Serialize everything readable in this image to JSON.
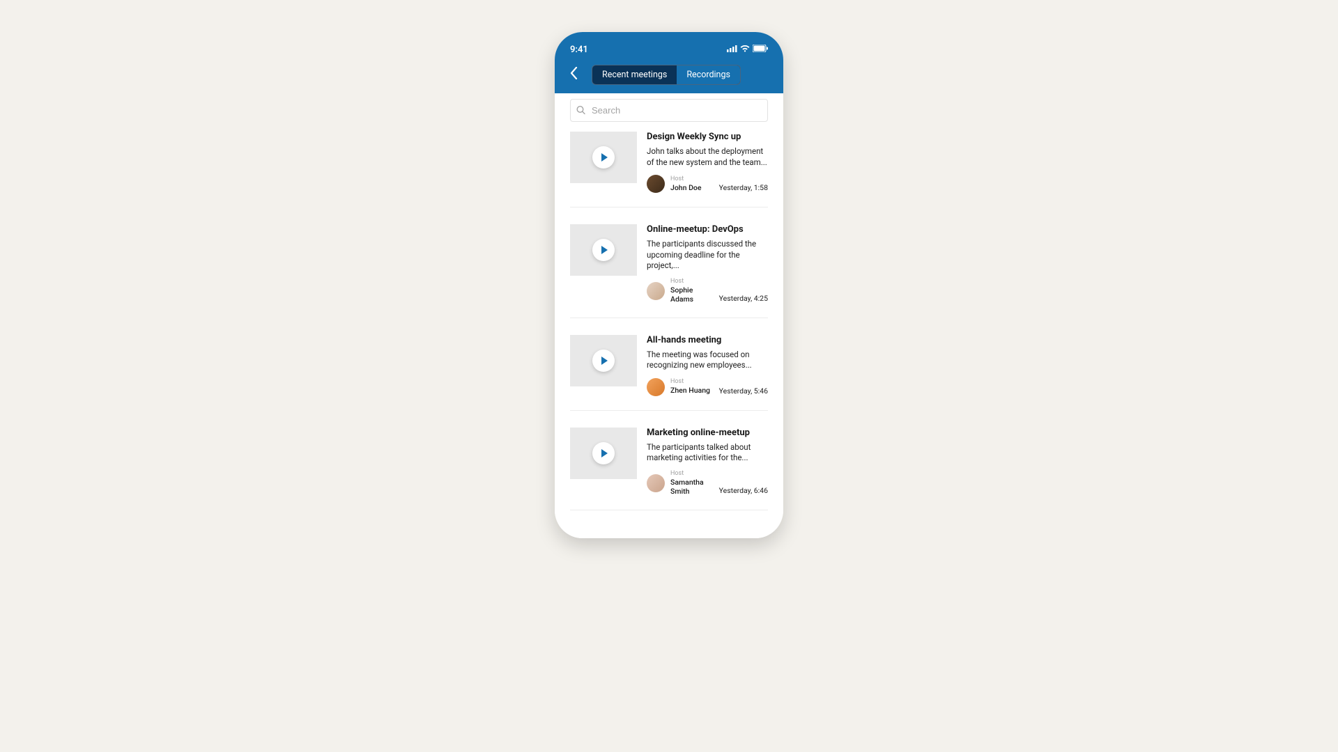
{
  "status": {
    "time": "9:41"
  },
  "tabs": {
    "recent": "Recent meetings",
    "recordings": "Recordings",
    "active": "recordings"
  },
  "search": {
    "placeholder": "Search",
    "value": ""
  },
  "host_label": "Host",
  "avatars": [
    {
      "bg": "linear-gradient(135deg,#6b4b2f,#3d2b1a)"
    },
    {
      "bg": "linear-gradient(135deg,#e6d3c4,#c9a98c)"
    },
    {
      "bg": "linear-gradient(135deg,#f2a25c,#d8792a)"
    },
    {
      "bg": "linear-gradient(135deg,#e5c8b8,#caa48c)"
    }
  ],
  "recordings": [
    {
      "title": "Design Weekly Sync up",
      "description": "John talks about the deployment of the new system and the team...",
      "host": "John Doe",
      "time": "Yesterday, 1:58"
    },
    {
      "title": "Online-meetup: DevOps",
      "description": "The participants discussed the upcoming deadline for the project,...",
      "host": "Sophie Adams",
      "time": "Yesterday, 4:25"
    },
    {
      "title": "All-hands meeting",
      "description": "The meeting was focused on recognizing new employees...",
      "host": "Zhen Huang",
      "time": "Yesterday, 5:46"
    },
    {
      "title": "Marketing online-meetup",
      "description": "The participants talked about marketing activities for the...",
      "host": "Samantha Smith",
      "time": "Yesterday, 6:46"
    }
  ]
}
